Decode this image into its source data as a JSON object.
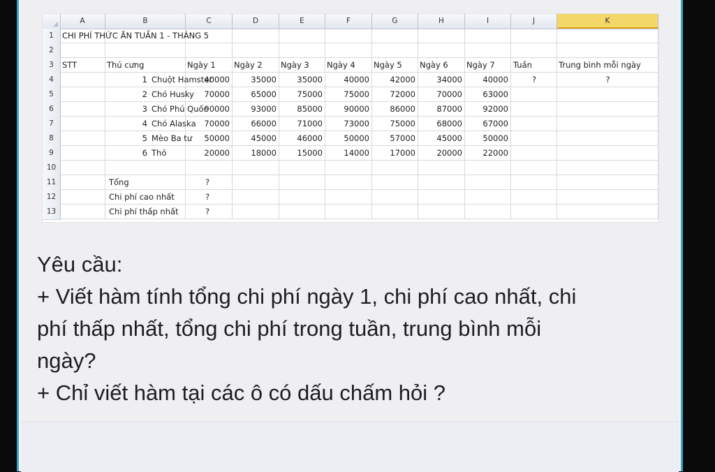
{
  "sheet": {
    "columns": [
      "A",
      "B",
      "C",
      "D",
      "E",
      "F",
      "G",
      "H",
      "I",
      "J",
      "K"
    ],
    "rows": [
      "1",
      "2",
      "3",
      "4",
      "5",
      "6",
      "7",
      "8",
      "9",
      "10",
      "11",
      "12",
      "13"
    ],
    "title": "CHI PHÍ THỨC ĂN TUẦN 1 - THÁNG 5",
    "headers": {
      "stt": "STT",
      "pet": "Thú cưng",
      "days": [
        "Ngày 1",
        "Ngày 2",
        "Ngày 3",
        "Ngày 4",
        "Ngày 5",
        "Ngày 6",
        "Ngày 7"
      ],
      "week": "Tuần",
      "avg": "Trung bình mỗi ngày"
    },
    "pets": [
      {
        "stt": "1",
        "name": "Chuột Hamster",
        "values": [
          "40000",
          "35000",
          "35000",
          "40000",
          "42000",
          "34000",
          "40000"
        ],
        "week": "?",
        "avg": "?"
      },
      {
        "stt": "2",
        "name": "Chó Husky",
        "values": [
          "70000",
          "65000",
          "75000",
          "75000",
          "72000",
          "70000",
          "63000"
        ],
        "week": "",
        "avg": ""
      },
      {
        "stt": "3",
        "name": "Chó Phú Quốc",
        "values": [
          "90000",
          "93000",
          "85000",
          "90000",
          "86000",
          "87000",
          "92000"
        ],
        "week": "",
        "avg": ""
      },
      {
        "stt": "4",
        "name": "Chó Alaska",
        "values": [
          "70000",
          "66000",
          "71000",
          "73000",
          "75000",
          "68000",
          "67000"
        ],
        "week": "",
        "avg": ""
      },
      {
        "stt": "5",
        "name": "Mèo Ba tư",
        "values": [
          "50000",
          "45000",
          "46000",
          "50000",
          "57000",
          "45000",
          "50000"
        ],
        "week": "",
        "avg": ""
      },
      {
        "stt": "6",
        "name": "Thỏ",
        "values": [
          "20000",
          "18000",
          "15000",
          "14000",
          "17000",
          "20000",
          "22000"
        ],
        "week": "",
        "avg": ""
      }
    ],
    "summary": [
      {
        "label": "Tổng",
        "value": "?"
      },
      {
        "label": "Chi phí cao nhất",
        "value": "?"
      },
      {
        "label": "Chi phí thấp nhất",
        "value": "?"
      }
    ],
    "active_column": "K"
  },
  "requirements": {
    "heading": "Yêu cầu:",
    "line1": "+ Viết hàm tính tổng chi phí ngày 1, chi phí cao nhất, chi",
    "line2": "phí thấp nhất, tổng chi phí trong tuần, trung bình mỗi",
    "line3": "ngày?",
    "line4": "+ Chỉ viết hàm tại các ô có dấu chấm hỏi ?"
  }
}
